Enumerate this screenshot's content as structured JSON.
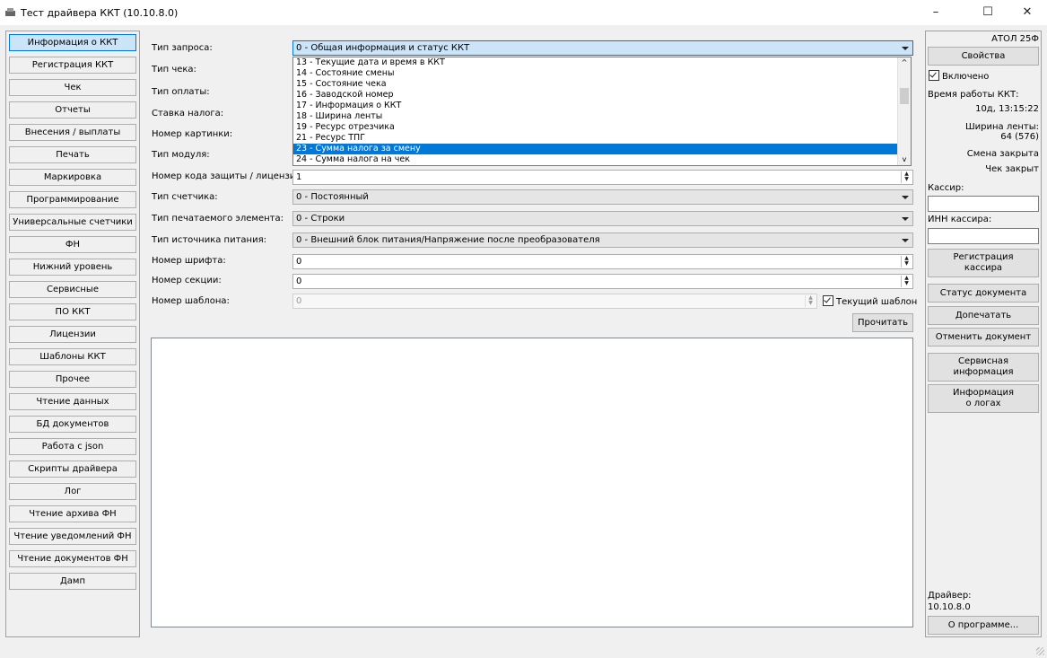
{
  "window": {
    "title": "Тест драйвера ККТ (10.10.8.0)",
    "minimize_glyph": "–",
    "maximize_glyph": "☐",
    "close_glyph": "✕"
  },
  "nav": [
    "Информация о ККТ",
    "Регистрация ККТ",
    "Чек",
    "Отчеты",
    "Внесения / выплаты",
    "Печать",
    "Маркировка",
    "Программирование",
    "Универсальные счетчики",
    "ФН",
    "Нижний уровень",
    "Сервисные",
    "ПО ККТ",
    "Лицензии",
    "Шаблоны ККТ",
    "Прочее",
    "Чтение данных",
    "БД документов",
    "Работа с json",
    "Скрипты драйвера",
    "Лог",
    "Чтение архива ФН",
    "Чтение уведомлений ФН",
    "Чтение документов ФН",
    "Дамп"
  ],
  "form": {
    "request_type_label": "Тип запроса:",
    "request_type_value": "0 - Общая информация и статус ККТ",
    "receipt_type_label": "Тип чека:",
    "payment_type_label": "Тип оплаты:",
    "tax_rate_label": "Ставка налога:",
    "picture_number_label": "Номер картинки:",
    "module_type_label": "Тип модуля:",
    "license_code_label": "Номер кода защиты / лицензии:",
    "license_code_value": "1",
    "counter_type_label": "Тип счетчика:",
    "counter_type_value": "0 - Постоянный",
    "print_element_label": "Тип печатаемого элемента:",
    "print_element_value": "0 - Строки",
    "power_source_label": "Тип источника питания:",
    "power_source_value": "0 - Внешний блок питания/Напряжение после преобразователя",
    "font_number_label": "Номер шрифта:",
    "font_number_value": "0",
    "section_number_label": "Номер секции:",
    "section_number_value": "0",
    "template_number_label": "Номер шаблона:",
    "template_number_value": "0",
    "current_template_label": "Текущий шаблон",
    "read_button": "Прочитать"
  },
  "dropdown": {
    "items": [
      "13 - Текущие дата и время в ККТ",
      "14 - Состояние смены",
      "15 - Состояние чека",
      "16 - Заводской номер",
      "17 - Информация о ККТ",
      "18 - Ширина ленты",
      "19 - Ресурс отрезчика",
      "21 - Ресурс ТПГ",
      "23 - Сумма налога за смену",
      "24 - Сумма налога на чек"
    ],
    "selected_index": 8
  },
  "right": {
    "model": "АТОЛ 25Ф",
    "properties_button": "Свойства",
    "enabled_label": "Включено",
    "uptime_label": "Время работы ККТ:",
    "uptime_value": "10д, 13:15:22",
    "tape_width_label": "Ширина ленты:",
    "tape_width_value": "64 (576)",
    "shift_status": "Смена закрыта",
    "receipt_status": "Чек закрыт",
    "cashier_label": "Кассир:",
    "cashier_inn_label": "ИНН кассира:",
    "register_cashier_line1": "Регистрация",
    "register_cashier_line2": "кассира",
    "doc_status_button": "Статус документа",
    "reprint_button": "Допечатать",
    "cancel_doc_button": "Отменить документ",
    "service_info_line1": "Сервисная",
    "service_info_line2": "информация",
    "logs_info_line1": "Информация",
    "logs_info_line2": "о логах",
    "driver_label": "Драйвер:",
    "driver_version": "10.10.8.0",
    "about_button": "О программе..."
  },
  "colors": {
    "selection": "#0078d7",
    "active_nav": "#cce4f7"
  }
}
